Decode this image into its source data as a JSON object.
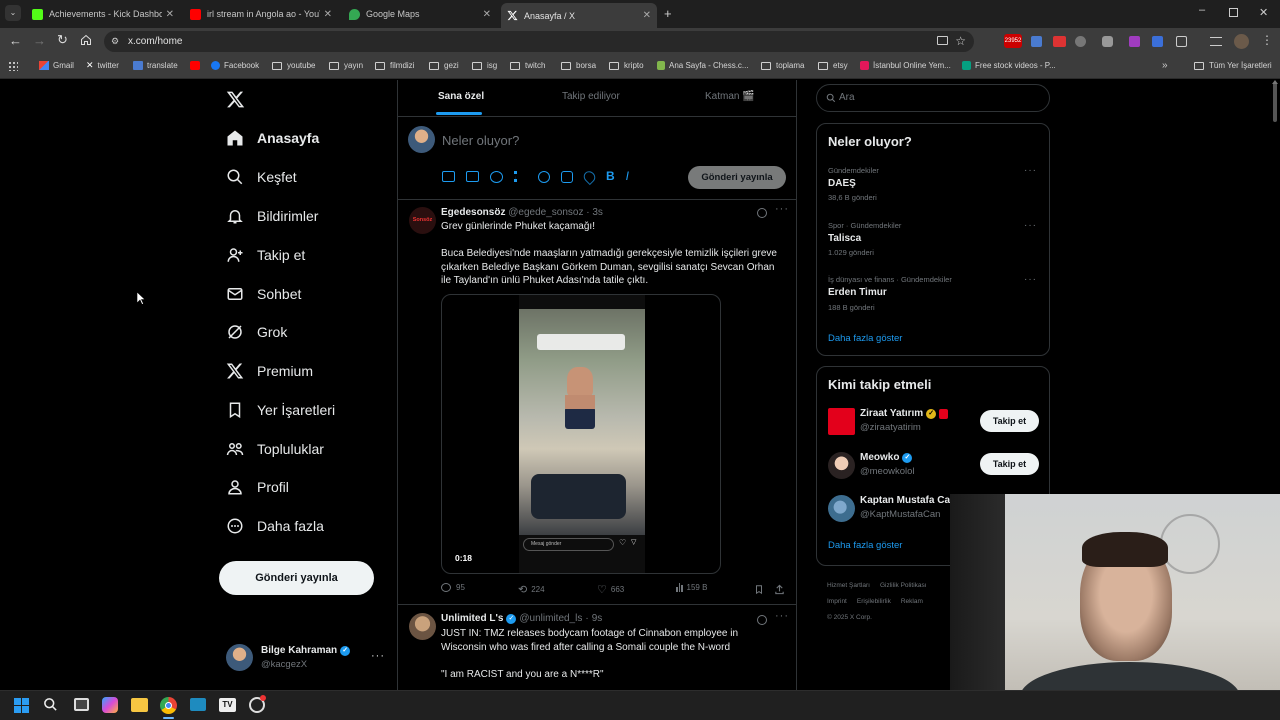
{
  "browser": {
    "tabs": [
      {
        "title": "Achievements - Kick Dashboard",
        "favicon_color": "#53fc18"
      },
      {
        "title": "irl stream in Angola ao - YouTube",
        "favicon_color": "#ff0000"
      },
      {
        "title": "Google Maps",
        "favicon_color": "#34a853"
      },
      {
        "title": "Anasayfa / X",
        "favicon_color": "#ffffff",
        "active": true
      }
    ],
    "url": "x.com/home",
    "extension_badge": "23952",
    "bookmarks": [
      {
        "label": "Gmail",
        "type": "link",
        "icon": "gmail-icon"
      },
      {
        "label": "twitter",
        "type": "link",
        "icon": "x-icon"
      },
      {
        "label": "translate",
        "type": "link",
        "icon": "translate-icon"
      },
      {
        "label": "",
        "type": "link",
        "icon": "youtube-icon"
      },
      {
        "label": "Facebook",
        "type": "link",
        "icon": "facebook-icon"
      },
      {
        "label": "youtube",
        "type": "folder"
      },
      {
        "label": "yayın",
        "type": "folder"
      },
      {
        "label": "filmdizi",
        "type": "folder"
      },
      {
        "label": "gezi",
        "type": "folder"
      },
      {
        "label": "isg",
        "type": "folder"
      },
      {
        "label": "twitch",
        "type": "folder"
      },
      {
        "label": "borsa",
        "type": "folder"
      },
      {
        "label": "kripto",
        "type": "folder"
      },
      {
        "label": "Ana Sayfa - Chess.c...",
        "type": "link",
        "icon": "chess-icon"
      },
      {
        "label": "toplama",
        "type": "folder"
      },
      {
        "label": "etsy",
        "type": "folder"
      },
      {
        "label": "İstanbul Online Yem...",
        "type": "link",
        "icon": "yemek-icon"
      },
      {
        "label": "Free stock videos - P...",
        "type": "link",
        "icon": "pexels-icon"
      }
    ],
    "all_bookmarks": "Tüm Yer İşaretleri"
  },
  "nav": {
    "items": [
      "Anasayfa",
      "Keşfet",
      "Bildirimler",
      "Takip et",
      "Sohbet",
      "Grok",
      "Premium",
      "Yer İşaretleri",
      "Topluluklar",
      "Profil",
      "Daha fazla"
    ],
    "post_button": "Gönderi yayınla",
    "account": {
      "name": "Bilge Kahraman",
      "handle": "@kacgezX"
    }
  },
  "timeline": {
    "tabs": [
      "Sana özel",
      "Takip ediliyor",
      "Katman 🎬"
    ],
    "composer_placeholder": "Neler oluyor?",
    "composer_button": "Gönderi yayınla",
    "tweets": [
      {
        "name": "Egedesonsöz",
        "handle": "@egede_sonsoz",
        "time": "3s",
        "avatar_text": "Sonsöz",
        "title_line": "Grev günlerinde Phuket kaçamağı!",
        "body": "Buca Belediyesi'nde maaşların yatmadığı gerekçesiyle temizlik işçileri greve çıkarken Belediye Başkanı Görkem Duman, sevgilisi sanatçı Sevcan Orhan ile Tayland'ın ünlü Phuket Adası'nda tatile çıktı.",
        "video_time": "0:18",
        "story_message": "Mesaj gönder",
        "replies": "95",
        "reposts": "224",
        "likes": "663",
        "views": "159 B"
      },
      {
        "name": "Unlimited L's",
        "handle": "@unlimited_ls",
        "time": "9s",
        "body": "JUST IN: TMZ releases bodycam footage of Cinnabon employee in Wisconsin who was fired after calling a Somali couple the N-word",
        "quote": "\"I am RACIST and you are a N****R\""
      }
    ]
  },
  "sidebar": {
    "search_placeholder": "Ara",
    "trends_title": "Neler oluyor?",
    "trends": [
      {
        "context": "Gündemdekiler",
        "name": "DAEŞ",
        "count": "38,6 B gönderi"
      },
      {
        "context": "Spor · Gündemdekiler",
        "name": "Talisca",
        "count": "1.029 gönderi"
      },
      {
        "context": "İş dünyası ve finans · Gündemdekiler",
        "name": "Erden Timur",
        "count": "188 B gönderi"
      }
    ],
    "trends_more": "Daha fazla göster",
    "who_title": "Kimi takip etmeli",
    "who": [
      {
        "name": "Ziraat Yatırım",
        "handle": "@ziraatyatirim",
        "button": "Takip et"
      },
      {
        "name": "Meowko",
        "handle": "@meowkolol",
        "button": "Takip et"
      },
      {
        "name": "Kaptan Mustafa Ca",
        "handle": "@KaptMustafaCan",
        "button": ""
      }
    ],
    "who_more": "Daha fazla göster",
    "footer": [
      "Hizmet Şartları",
      "Gizlilik Politikası",
      "Imprint",
      "Erişilebilirlik",
      "Reklam",
      "© 2025 X Corp."
    ]
  },
  "colors": {
    "accent": "#1d9bf0",
    "background": "#000000",
    "border": "#2f3336"
  }
}
